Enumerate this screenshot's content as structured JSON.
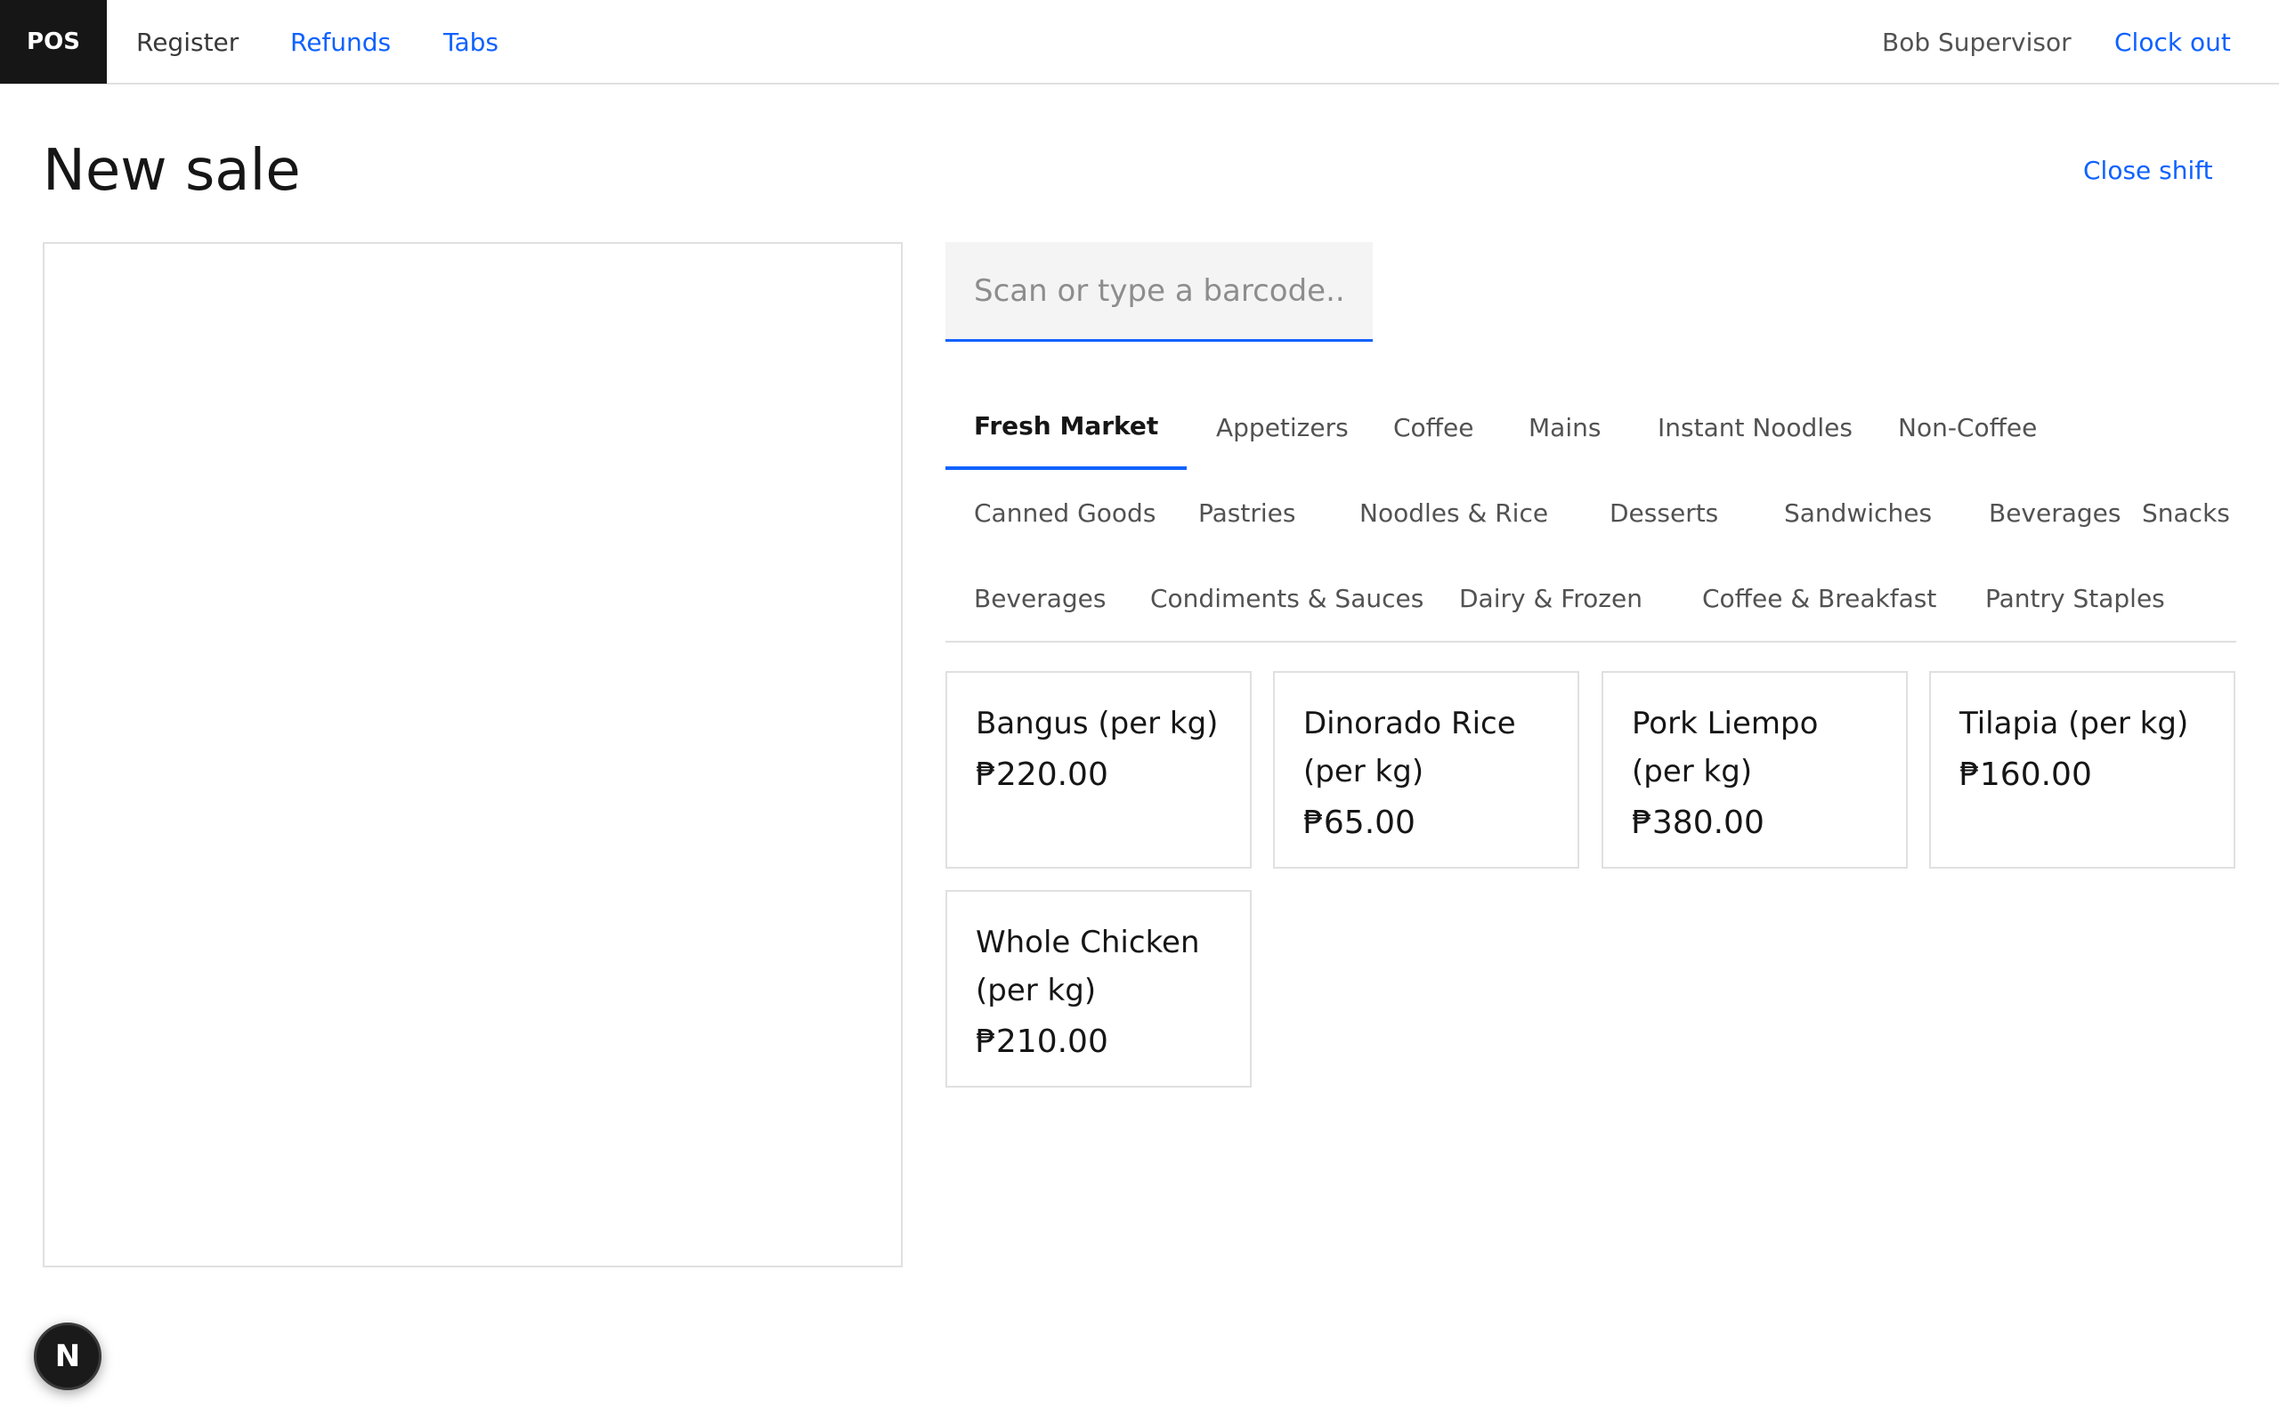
{
  "header": {
    "brand": "POS",
    "nav": {
      "register": "Register",
      "refunds": "Refunds",
      "tabs": "Tabs"
    },
    "user": "Bob Supervisor",
    "clock_out": "Clock out"
  },
  "page": {
    "title": "New sale",
    "close_shift": "Close shift"
  },
  "barcode": {
    "placeholder": "Scan or type a barcode...",
    "value": ""
  },
  "categories": [
    {
      "label": "Fresh Market",
      "active": true
    },
    {
      "label": "Appetizers",
      "active": false
    },
    {
      "label": "Coffee",
      "active": false
    },
    {
      "label": "Mains",
      "active": false
    },
    {
      "label": "Instant Noodles",
      "active": false
    },
    {
      "label": "Non-Coffee",
      "active": false
    },
    {
      "label": "Canned Goods",
      "active": false
    },
    {
      "label": "Pastries",
      "active": false
    },
    {
      "label": "Noodles & Rice",
      "active": false
    },
    {
      "label": "Desserts",
      "active": false
    },
    {
      "label": "Sandwiches",
      "active": false
    },
    {
      "label": "Beverages",
      "active": false
    },
    {
      "label": "Snacks",
      "active": false
    },
    {
      "label": "Beverages",
      "active": false
    },
    {
      "label": "Condiments & Sauces",
      "active": false
    },
    {
      "label": "Dairy & Frozen",
      "active": false
    },
    {
      "label": "Coffee & Breakfast",
      "active": false
    },
    {
      "label": "Pantry Staples",
      "active": false
    }
  ],
  "products": [
    {
      "name": "Bangus (per kg)",
      "price": "₱220.00"
    },
    {
      "name": "Dinorado Rice (per kg)",
      "price": "₱65.00"
    },
    {
      "name": "Pork Liempo (per kg)",
      "price": "₱380.00"
    },
    {
      "name": "Tilapia (per kg)",
      "price": "₱160.00"
    },
    {
      "name": "Whole Chicken (per kg)",
      "price": "₱210.00"
    }
  ],
  "dev_badge": "N",
  "colors": {
    "accent": "#0f62fe",
    "brand_bg": "#161616",
    "border": "#e0e0e0"
  }
}
